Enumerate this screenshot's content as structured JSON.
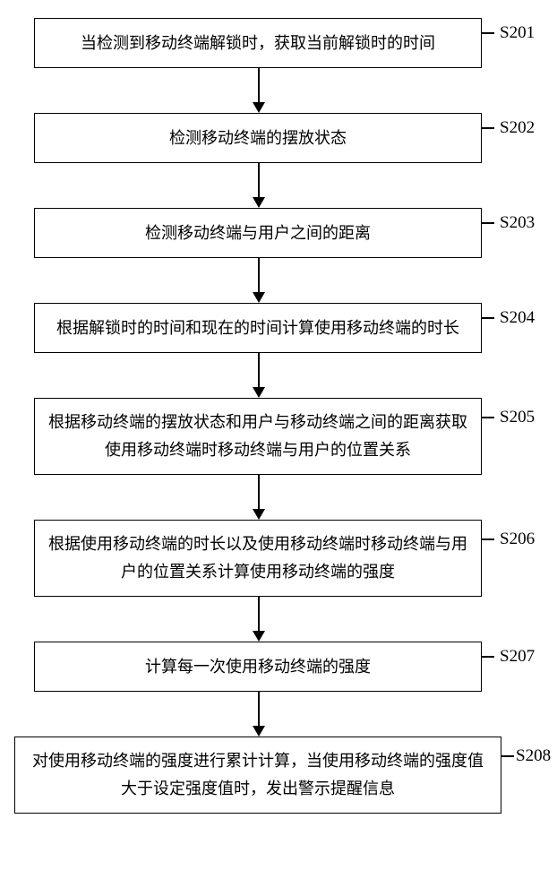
{
  "flowchart": {
    "steps": [
      {
        "id": "S201",
        "text": "当检测到移动终端解锁时，获取当前解锁时的时间"
      },
      {
        "id": "S202",
        "text": "检测移动终端的摆放状态"
      },
      {
        "id": "S203",
        "text": "检测移动终端与用户之间的距离"
      },
      {
        "id": "S204",
        "text": "根据解锁时的时间和现在的时间计算使用移动终端的时长"
      },
      {
        "id": "S205",
        "text": "根据移动终端的摆放状态和用户与移动终端之间的距离获取使用移动终端时移动终端与用户的位置关系"
      },
      {
        "id": "S206",
        "text": "根据使用移动终端的时长以及使用移动终端时移动终端与用户的位置关系计算使用移动终端的强度"
      },
      {
        "id": "S207",
        "text": "计算每一次使用移动终端的强度"
      },
      {
        "id": "S208",
        "text": "对使用移动终端的强度进行累计计算，当使用移动终端的强度值大于设定强度值时，发出警示提醒信息"
      }
    ]
  }
}
